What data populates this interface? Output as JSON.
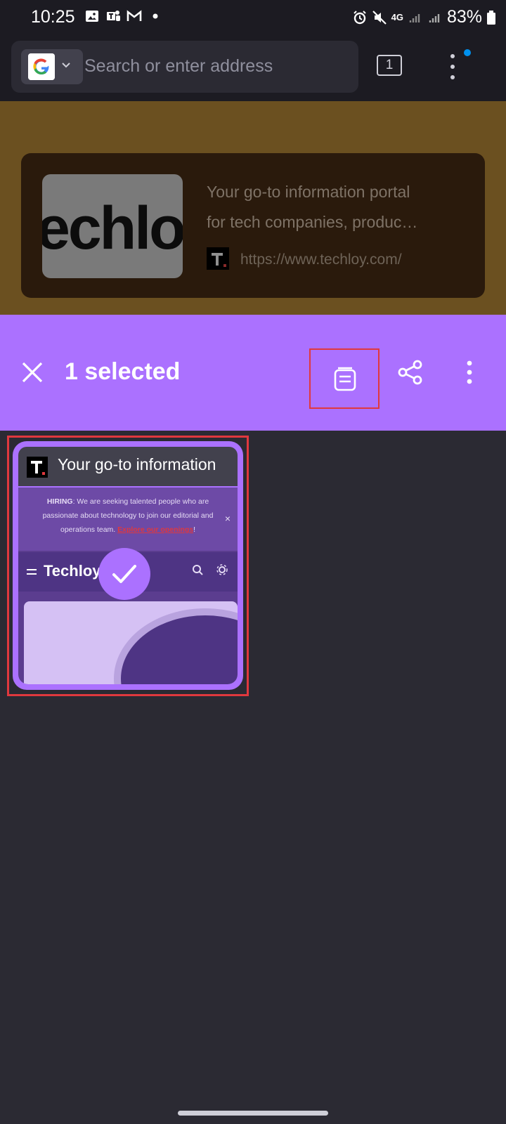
{
  "status_bar": {
    "time": "10:25",
    "network": "4G",
    "battery": "83%"
  },
  "toolbar": {
    "search_placeholder": "Search or enter address",
    "tab_count": "1"
  },
  "background_page": {
    "link_card": {
      "thumb_text": "echlo",
      "description_line1": "Your go-to information portal",
      "description_line2": "for tech companies, produc…",
      "url": "https://www.techloy.com/"
    }
  },
  "selection_bar": {
    "selected_label": "1 selected"
  },
  "tabs": [
    {
      "title": "Your go-to information",
      "thumbnail": {
        "hiring_prefix": "HIRING",
        "hiring_text": ": We are seeking talented people who are passionate about technology to join our editorial and operations team.",
        "hiring_link": "Explore our openings",
        "hiring_end": "!",
        "site_logo": "Techloy",
        "close_glyph": "×"
      },
      "selected": true
    }
  ],
  "colors": {
    "accent": "#ab71ff",
    "highlight": "#e0383e",
    "background": "#2b2a33"
  }
}
